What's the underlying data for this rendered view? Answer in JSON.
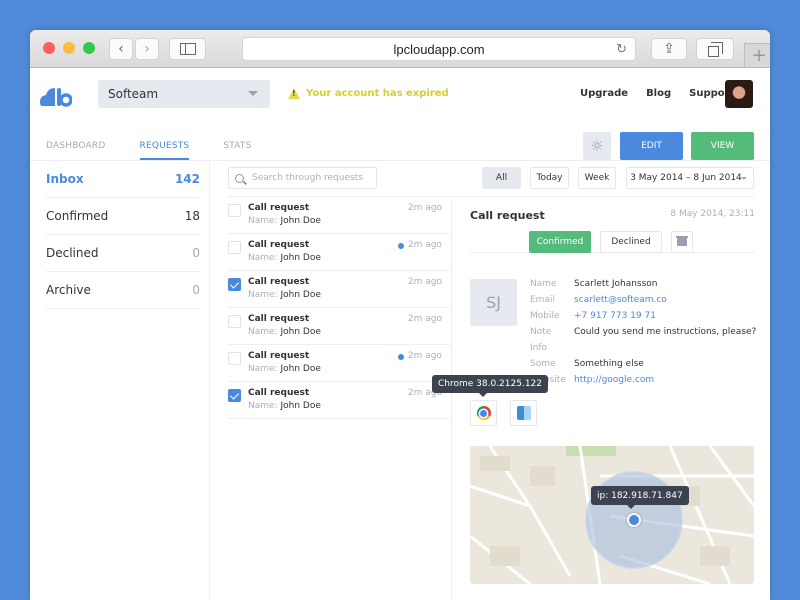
{
  "browser": {
    "url": "lpcloudapp.com"
  },
  "header": {
    "team": "Softeam",
    "warning": "Your account has expired",
    "links": [
      "Upgrade",
      "Blog",
      "Support"
    ]
  },
  "nav": {
    "tabs": [
      {
        "label": "DASHBOARD",
        "active": false
      },
      {
        "label": "REQUESTS",
        "active": true
      },
      {
        "label": "STATS",
        "active": false
      }
    ],
    "edit_label": "EDIT",
    "view_label": "VIEW"
  },
  "folders": [
    {
      "label": "Inbox",
      "count": "142"
    },
    {
      "label": "Confirmed",
      "count": "18"
    },
    {
      "label": "Declined",
      "count": "0"
    },
    {
      "label": "Archive",
      "count": "0"
    }
  ],
  "search": {
    "placeholder": "Search through requests"
  },
  "filters": {
    "all": "All",
    "today": "Today",
    "week": "Week",
    "date_range": "3 May 2014 – 8 Jun 2014"
  },
  "requests": [
    {
      "title": "Call request",
      "name_label": "Name:",
      "name": "John Doe",
      "time": "2m ago",
      "checked": false,
      "unread": false
    },
    {
      "title": "Call request",
      "name_label": "Name:",
      "name": "John Doe",
      "time": "2m ago",
      "checked": false,
      "unread": true
    },
    {
      "title": "Call request",
      "name_label": "Name:",
      "name": "John Doe",
      "time": "2m ago",
      "checked": true,
      "unread": false
    },
    {
      "title": "Call request",
      "name_label": "Name:",
      "name": "John Doe",
      "time": "2m ago",
      "checked": false,
      "unread": false
    },
    {
      "title": "Call request",
      "name_label": "Name:",
      "name": "John Doe",
      "time": "2m ago",
      "checked": false,
      "unread": true
    },
    {
      "title": "Call request",
      "name_label": "Name:",
      "name": "John Doe",
      "time": "2m ago",
      "checked": true,
      "unread": false
    }
  ],
  "detail": {
    "title": "Call request",
    "date": "8 May 2014, 23:11",
    "confirmed_label": "Confirmed",
    "declined_label": "Declined",
    "initials": "SJ",
    "fields": [
      {
        "key": "Name",
        "value": "Scarlett Johansson",
        "link": false
      },
      {
        "key": "Email",
        "value": "scarlett@softeam.co",
        "link": true
      },
      {
        "key": "Mobile",
        "value": "+7 917 773 19 71",
        "link": true
      },
      {
        "key": "Note",
        "value": "Could you send me instructions, please?",
        "link": false
      },
      {
        "key": "Info",
        "value": "",
        "link": false
      },
      {
        "key": "Some",
        "value": "Something else",
        "link": false
      },
      {
        "key": "Website",
        "value": "http://google.com",
        "link": true
      }
    ],
    "browser_tooltip": "Chrome 38.0.2125.122",
    "ip": "ip: 182.918.71.847"
  },
  "colors": {
    "accent": "#4a89dc",
    "success": "#55bb7b",
    "warning": "#d9cd28",
    "background": "#528bd9"
  }
}
